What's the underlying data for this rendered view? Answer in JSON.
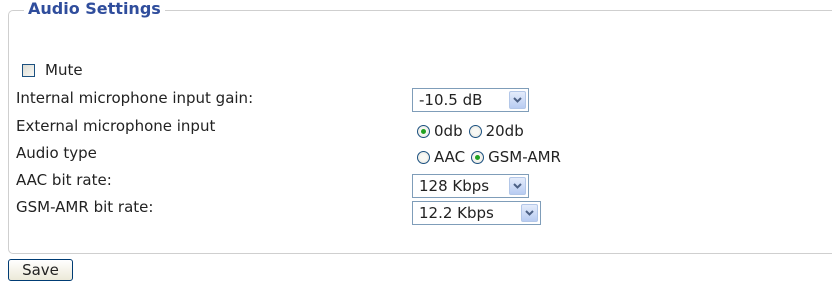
{
  "audio_settings": {
    "legend": "Audio Settings",
    "mute": {
      "label": "Mute",
      "checked": false
    },
    "internal_gain": {
      "label": "Internal microphone input gain:",
      "value": "-10.5 dB"
    },
    "external_input": {
      "label": "External microphone input",
      "options": [
        {
          "label": "0db",
          "selected": true
        },
        {
          "label": "20db",
          "selected": false
        }
      ]
    },
    "audio_type": {
      "label": "Audio type",
      "options": [
        {
          "label": "AAC",
          "selected": false
        },
        {
          "label": "GSM-AMR",
          "selected": true
        }
      ]
    },
    "aac_bit_rate": {
      "label": "AAC bit rate:",
      "value": "128 Kbps"
    },
    "gsm_bit_rate": {
      "label": "GSM-AMR bit rate:",
      "value": "12.2 Kbps"
    }
  },
  "actions": {
    "save_label": "Save"
  },
  "icons": {
    "dropdown": "chevron-down-icon",
    "checkbox": "checkbox-unchecked",
    "radio_selected_color": "#21a121"
  }
}
